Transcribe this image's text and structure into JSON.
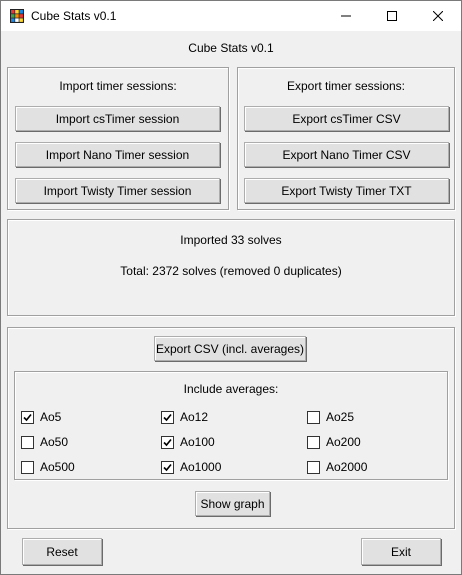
{
  "window": {
    "title": "Cube Stats v0.1",
    "controls": {
      "minimize_icon": "minimize-icon",
      "maximize_icon": "maximize-icon",
      "close_icon": "close-icon"
    }
  },
  "heading": "Cube Stats v0.1",
  "import": {
    "title": "Import timer sessions:",
    "buttons": [
      "Import csTimer session",
      "Import Nano Timer session",
      "Import Twisty Timer session"
    ]
  },
  "export": {
    "title": "Export timer sessions:",
    "buttons": [
      "Export csTimer CSV",
      "Export Nano Timer CSV",
      "Export Twisty Timer TXT"
    ]
  },
  "status": {
    "imported": "Imported 33 solves",
    "total": "Total: 2372 solves (removed 0 duplicates)"
  },
  "averages": {
    "export_csv_label": "Export CSV (incl. averages)",
    "include_title": "Include averages:",
    "options": [
      {
        "label": "Ao5",
        "checked": true
      },
      {
        "label": "Ao12",
        "checked": true
      },
      {
        "label": "Ao25",
        "checked": false
      },
      {
        "label": "Ao50",
        "checked": false
      },
      {
        "label": "Ao100",
        "checked": true
      },
      {
        "label": "Ao200",
        "checked": false
      },
      {
        "label": "Ao500",
        "checked": false
      },
      {
        "label": "Ao1000",
        "checked": true
      },
      {
        "label": "Ao2000",
        "checked": false
      }
    ],
    "show_graph_label": "Show graph"
  },
  "footer": {
    "reset_label": "Reset",
    "exit_label": "Exit"
  }
}
